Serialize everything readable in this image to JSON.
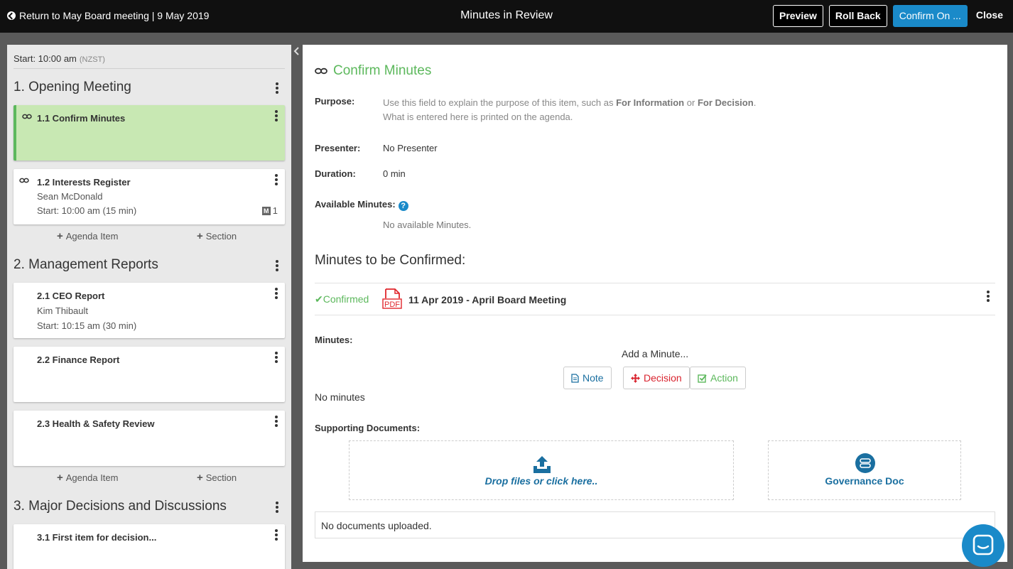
{
  "topbar": {
    "back_label": "Return to May Board meeting | 9 May 2019",
    "title": "Minutes in Review",
    "preview": "Preview",
    "rollback": "Roll Back",
    "confirm_on": "Confirm On ...",
    "close": "Close"
  },
  "agenda": {
    "start_label": "Start: 10:00 am",
    "timezone": "(NZST)",
    "add_item": "Agenda Item",
    "add_section": "Section",
    "sections": [
      {
        "title": "1. Opening Meeting"
      },
      {
        "title": "2. Management Reports"
      },
      {
        "title": "3. Major Decisions and Discussions"
      }
    ],
    "items": [
      {
        "title": "1.1 Confirm Minutes"
      },
      {
        "title": "1.2 Interests Register",
        "presenter": "Sean McDonald",
        "start": "Start: 10:00 am (15 min)",
        "minutes_count": "1"
      },
      {
        "title": "2.1 CEO Report",
        "presenter": "Kim Thibault",
        "start": "Start: 10:15 am (30 min)"
      },
      {
        "title": "2.2 Finance Report"
      },
      {
        "title": "2.3 Health & Safety Review"
      },
      {
        "title": "3.1 First item for decision..."
      }
    ]
  },
  "detail": {
    "title": "Confirm Minutes",
    "purpose_label": "Purpose:",
    "purpose_hint_1": "Use this field to explain the purpose of this item, such as",
    "purpose_hint_for_info": "For Information",
    "purpose_hint_or": "or",
    "purpose_hint_for_decision": "For Decision",
    "purpose_hint_2": "What is entered here is printed on the agenda.",
    "presenter_label": "Presenter:",
    "presenter_value": "No Presenter",
    "duration_label": "Duration:",
    "duration_value": "0 min",
    "available_label": "Available Minutes:",
    "available_value": "No available Minutes.",
    "to_confirm_heading": "Minutes to be Confirmed:",
    "confirmed_status": "Confirmed",
    "pdf_label": "PDF",
    "minutes_doc": "11 Apr 2019 - April Board Meeting",
    "minutes_label": "Minutes:",
    "add_minute": "Add a Minute...",
    "note_btn": "Note",
    "decision_btn": "Decision",
    "action_btn": "Action",
    "no_minutes": "No minutes",
    "supporting_label": "Supporting Documents:",
    "drop_label": "Drop files or click here..",
    "governance_label": "Governance Doc",
    "no_docs": "No documents uploaded."
  },
  "colors": {
    "accent_green": "#5cb85c",
    "accent_blue": "#1a8ac9",
    "decision_red": "#d9232e",
    "pdf_red": "#e0262c"
  }
}
